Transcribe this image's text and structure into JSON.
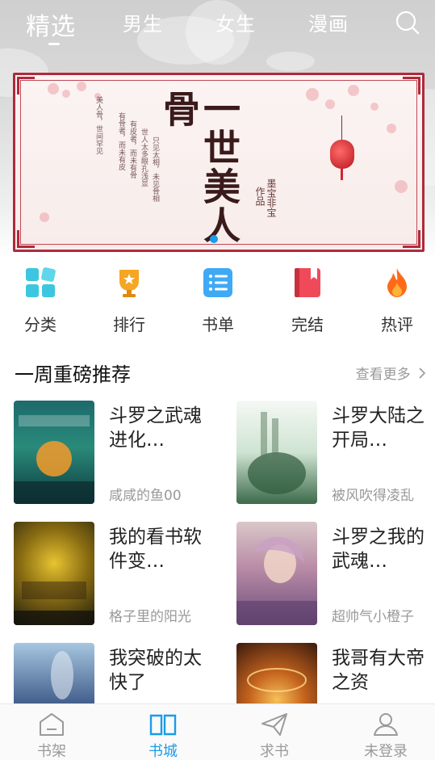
{
  "top_tabs": {
    "items": [
      {
        "label": "精选",
        "active": true
      },
      {
        "label": "男生",
        "active": false
      },
      {
        "label": "女生",
        "active": false
      },
      {
        "label": "漫画",
        "active": false
      }
    ],
    "search_icon": "search-icon"
  },
  "banner": {
    "title": "一世美人骨",
    "author": "墨宝非宝",
    "author_suffix": "作品",
    "poem_lines": [
      "只见太相，未见骨相",
      "世人太多眼孔浅显",
      "有皮者，而未有骨",
      "有骨者，而未有皮",
      "美人骨，世间罕见"
    ],
    "slide_count": 1,
    "active_slide": 0
  },
  "categories": [
    {
      "label": "分类",
      "icon": "grid-icon",
      "color": "#3cc6e0"
    },
    {
      "label": "排行",
      "icon": "trophy-icon",
      "color": "#f5a623"
    },
    {
      "label": "书单",
      "icon": "list-icon",
      "color": "#3fa9f5"
    },
    {
      "label": "完结",
      "icon": "bookmark-book-icon",
      "color": "#f04a5a"
    },
    {
      "label": "热评",
      "icon": "flame-icon",
      "color": "#ff6a1a"
    }
  ],
  "section": {
    "title": "一周重磅推荐",
    "more": "查看更多"
  },
  "books": [
    {
      "title": "斗罗之武魂进化…",
      "author": "咸咸的鱼00"
    },
    {
      "title": "斗罗大陆之开局…",
      "author": "被风吹得凌乱"
    },
    {
      "title": "我的看书软件变…",
      "author": "格子里的阳光"
    },
    {
      "title": "斗罗之我的武魂…",
      "author": "超帅气小橙子"
    },
    {
      "title": "我突破的太快了",
      "author": ""
    },
    {
      "title": "我哥有大帝之资",
      "author": ""
    }
  ],
  "bottom_nav": [
    {
      "label": "书架",
      "icon": "bookshelf-icon",
      "active": false
    },
    {
      "label": "书城",
      "icon": "open-book-icon",
      "active": true
    },
    {
      "label": "求书",
      "icon": "paper-plane-icon",
      "active": false
    },
    {
      "label": "未登录",
      "icon": "user-icon",
      "active": false
    }
  ],
  "colors": {
    "accent": "#1a9ce8",
    "text_primary": "#222222",
    "text_secondary": "#999999",
    "banner_frame": "#b02a3a"
  }
}
